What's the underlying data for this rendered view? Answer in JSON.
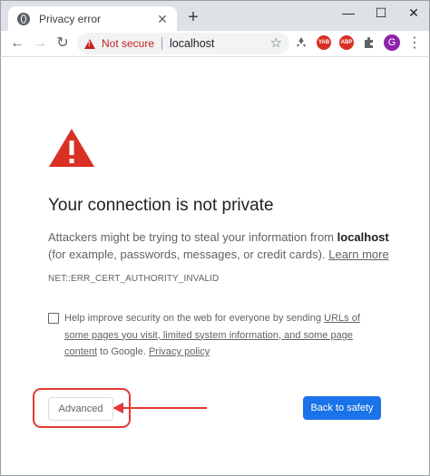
{
  "tab": {
    "title": "Privacy error",
    "close": "✕"
  },
  "newtab": "+",
  "window": {
    "minimize": "—",
    "maximize": "☐",
    "close": "✕"
  },
  "nav": {
    "back": "←",
    "forward": "→",
    "reload": "↻"
  },
  "omnibox": {
    "security_label": "Not secure",
    "url": "localhost",
    "star": "☆"
  },
  "extensions": {
    "yab_label": "YAB",
    "abp_label": "ABP",
    "avatar_letter": "G",
    "menu": "⋮",
    "yab_color": "#d93025",
    "abp_color": "#d93025"
  },
  "page": {
    "heading": "Your connection is not private",
    "desc_part1": "Attackers might be trying to steal your information from ",
    "desc_host": "localhost",
    "desc_part2": " (for example, passwords, messages, or credit cards). ",
    "learn_more": "Learn more",
    "error_code": "NET::ERR_CERT_AUTHORITY_INVALID",
    "help_part1": "Help improve security on the web for everyone by sending ",
    "help_link1": "URLs of some pages you visit, limited system information, and some page content",
    "help_part2": " to Google. ",
    "help_link2": "Privacy policy",
    "advanced_label": "Advanced",
    "safety_label": "Back to safety"
  },
  "colors": {
    "warning_red": "#d93025",
    "annotation_red": "#e53935",
    "primary_blue": "#1a73e8"
  }
}
